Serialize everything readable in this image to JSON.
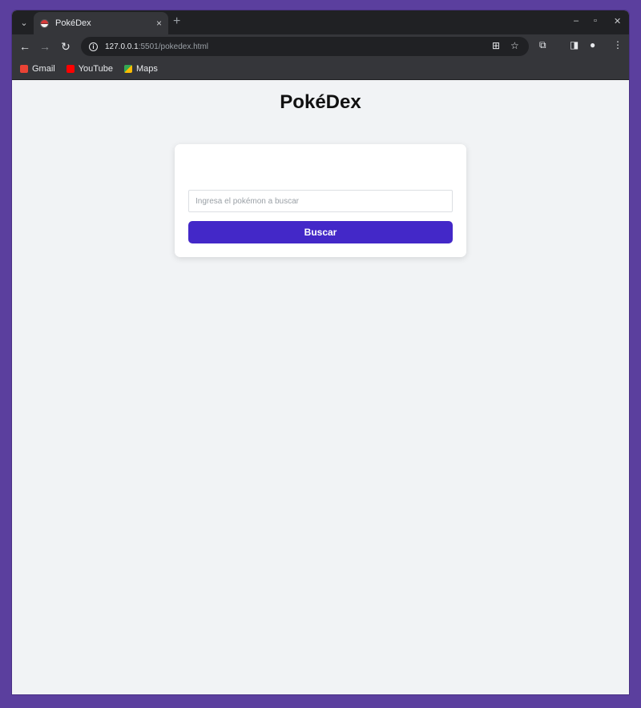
{
  "browser": {
    "tab_title": "PokéDex",
    "tab_close": "×",
    "new_tab": "+",
    "url_host": "127.0.0.1",
    "url_path": ":5501/pokedex.html",
    "bookmarks": [
      {
        "label": "Gmail",
        "icon": "gmail-icon",
        "color": "#ea4335"
      },
      {
        "label": "YouTube",
        "icon": "youtube-icon",
        "color": "#ff0000"
      },
      {
        "label": "Maps",
        "icon": "maps-icon",
        "color": "#34a853"
      }
    ]
  },
  "page": {
    "title": "PokéDex",
    "search": {
      "placeholder": "Ingresa el pokémon a buscar",
      "value": ""
    },
    "button_label": "Buscar",
    "accent_color": "#4328c8"
  }
}
